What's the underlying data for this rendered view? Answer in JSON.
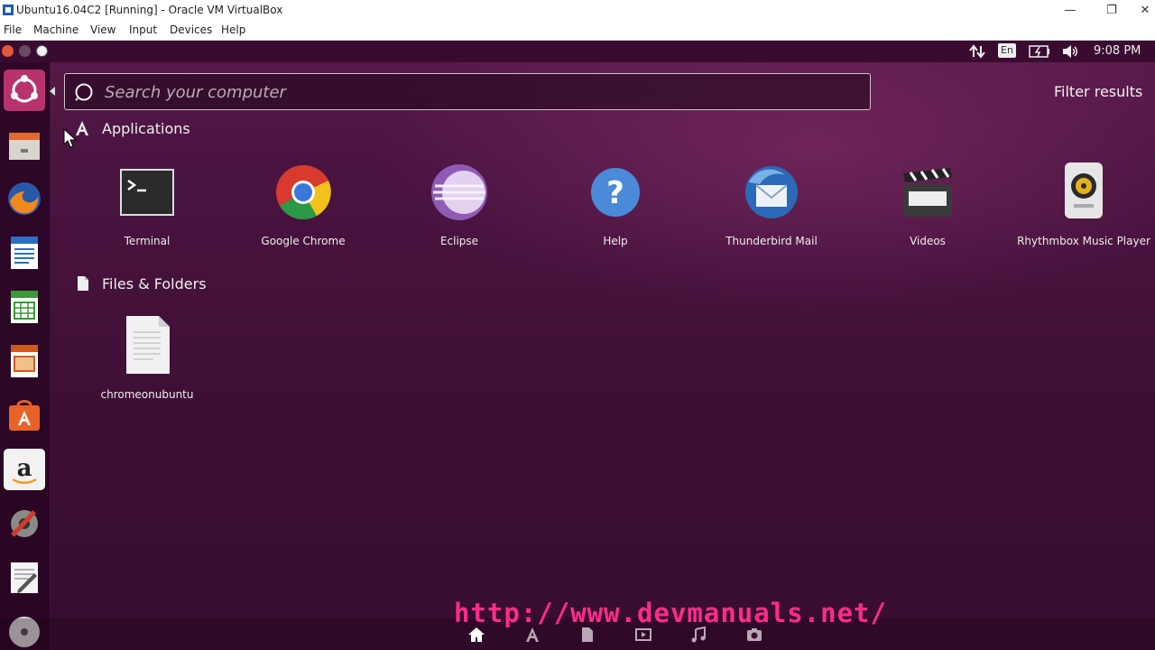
{
  "host_window": {
    "title": "Ubuntu16.04C2 [Running] - Oracle VM VirtualBox",
    "menu": [
      "File",
      "Machine",
      "View",
      "Input",
      "Devices",
      "Help"
    ],
    "controls": {
      "minimize": "—",
      "restore": "❐",
      "close": "✕"
    }
  },
  "top_panel": {
    "language": "En",
    "time": "9:08 PM"
  },
  "dash": {
    "search_placeholder": "Search your computer",
    "filter_results": "Filter results",
    "applications": {
      "heading": "Applications",
      "items": [
        {
          "label": "Terminal",
          "icon": "terminal-icon"
        },
        {
          "label": "Google Chrome",
          "icon": "chrome-icon"
        },
        {
          "label": "Eclipse",
          "icon": "eclipse-icon"
        },
        {
          "label": "Help",
          "icon": "help-icon"
        },
        {
          "label": "Thunderbird Mail",
          "icon": "thunderbird-icon"
        },
        {
          "label": "Videos",
          "icon": "videos-icon"
        },
        {
          "label": "Rhythmbox Music Player",
          "icon": "rhythmbox-icon"
        }
      ]
    },
    "files": {
      "heading": "Files & Folders",
      "items": [
        {
          "label": "chromeonubuntu",
          "icon": "document-icon"
        }
      ]
    }
  },
  "launcher_items": [
    "ubuntu-dash-icon",
    "files-icon",
    "firefox-icon",
    "writer-icon",
    "calc-icon",
    "impress-icon",
    "software-center-icon",
    "amazon-icon",
    "settings-icon",
    "text-editor-icon",
    "dvd-icon"
  ],
  "lenses": [
    "home-lens-icon",
    "applications-lens-icon",
    "files-lens-icon",
    "videos-lens-icon",
    "music-lens-icon",
    "photos-lens-icon"
  ],
  "watermark": "http://www.devmanuals.net/",
  "colors": {
    "watermark": "#ff2b8c",
    "background": "#3c0f32"
  }
}
